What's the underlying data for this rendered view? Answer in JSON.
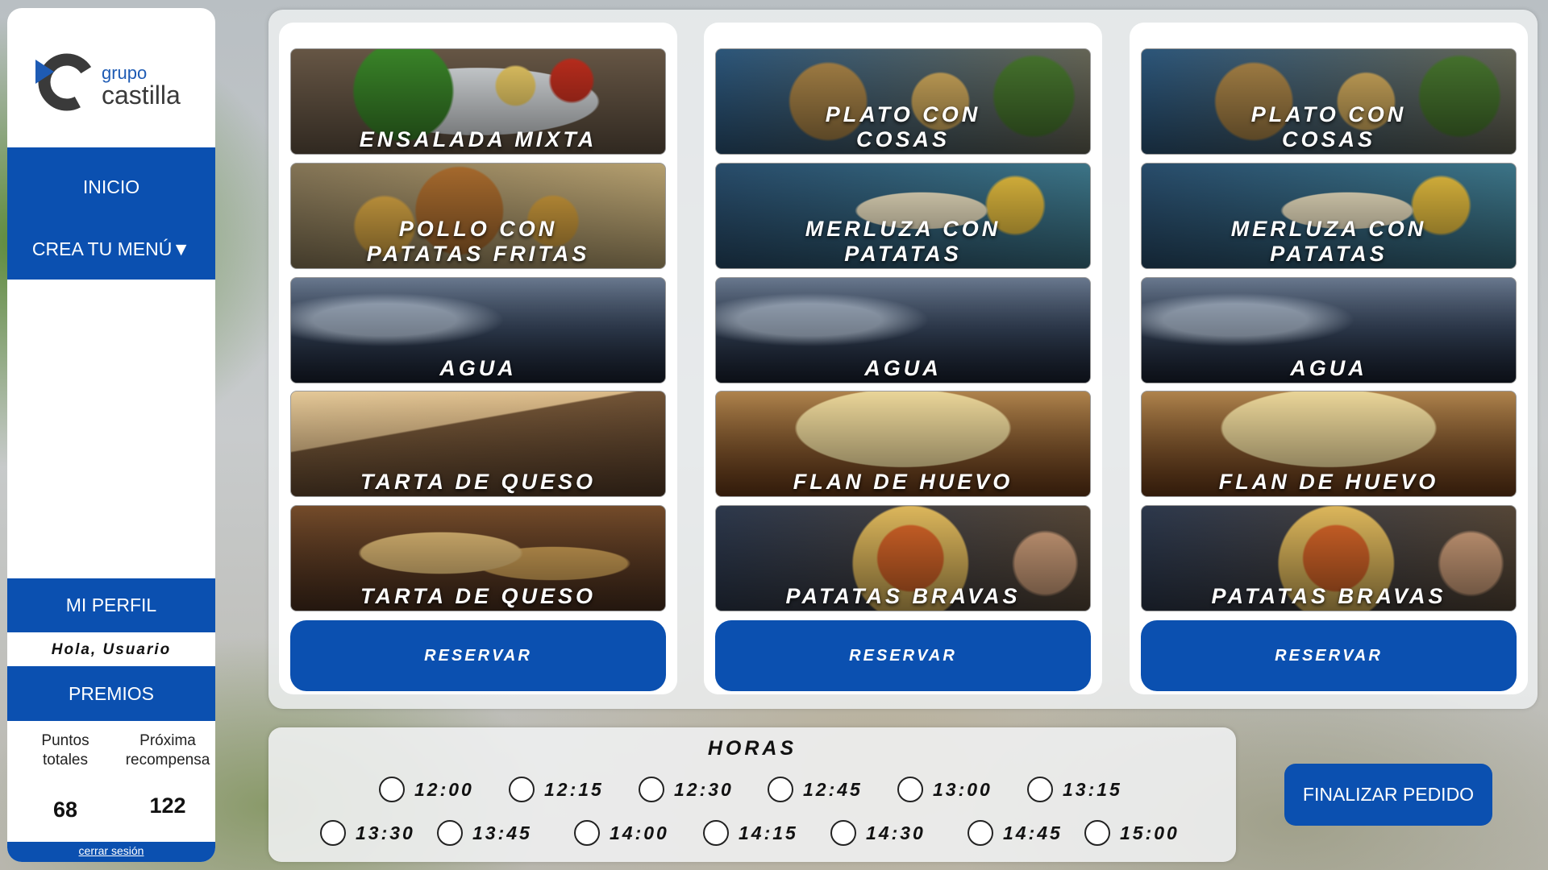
{
  "brand": {
    "line1": "grupo",
    "line2": "castilla",
    "color": "#0b50b0"
  },
  "nav": {
    "inicio": "INICIO",
    "crea_menu": "CREA TU MENÚ▼"
  },
  "profile": {
    "button": "MI PERFIL",
    "greeting": "Hola, Usuario"
  },
  "rewards": {
    "button": "PREMIOS",
    "total_label": "Puntos\ntotales",
    "next_label": "Próxima\nrecompensa",
    "total_value": "68",
    "next_value": "122"
  },
  "logout": "cerrar sesión",
  "menus": [
    {
      "dishes": [
        {
          "name": "ENSALADA MIXTA",
          "image": "salad"
        },
        {
          "name": "POLLO CON\nPATATAS FRITAS",
          "image": "pollo"
        },
        {
          "name": "AGUA",
          "image": "agua"
        },
        {
          "name": "TARTA DE QUESO",
          "image": "tarta"
        },
        {
          "name": "TARTA DE QUESO",
          "image": "pan"
        }
      ],
      "reserve": "RESERVAR"
    },
    {
      "dishes": [
        {
          "name": "PLATO CON\nCOSAS",
          "image": "plato"
        },
        {
          "name": "MERLUZA CON\nPATATAS",
          "image": "merluza"
        },
        {
          "name": "AGUA",
          "image": "agua"
        },
        {
          "name": "FLAN DE HUEVO",
          "image": "flan"
        },
        {
          "name": "PATATAS BRAVAS",
          "image": "bravas"
        }
      ],
      "reserve": "RESERVAR"
    },
    {
      "dishes": [
        {
          "name": "PLATO CON\nCOSAS",
          "image": "plato"
        },
        {
          "name": "MERLUZA CON\nPATATAS",
          "image": "merluza"
        },
        {
          "name": "AGUA",
          "image": "agua"
        },
        {
          "name": "FLAN DE HUEVO",
          "image": "flan"
        },
        {
          "name": "PATATAS BRAVAS",
          "image": "bravas"
        }
      ],
      "reserve": "RESERVAR"
    }
  ],
  "hours": {
    "title": "HORAS",
    "slots": [
      "12:00",
      "12:15",
      "12:30",
      "12:45",
      "13:00",
      "13:15",
      "13:30",
      "13:45",
      "14:00",
      "14:15",
      "14:30",
      "14:45",
      "15:00"
    ]
  },
  "finalize": "FINALIZAR PEDIDO"
}
